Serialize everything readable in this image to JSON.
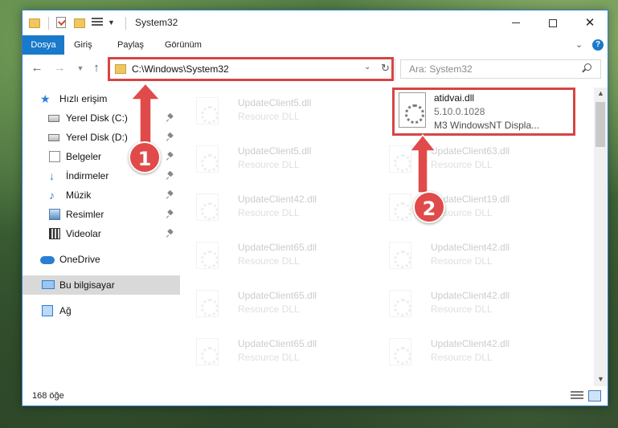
{
  "window": {
    "title": "System32"
  },
  "ribbon": {
    "tabs": [
      {
        "label": "Dosya"
      },
      {
        "label": "Giriş"
      },
      {
        "label": "Paylaş"
      },
      {
        "label": "Görünüm"
      }
    ]
  },
  "navigation": {
    "address": "C:\\Windows\\System32",
    "search_placeholder": "Ara: System32"
  },
  "sidebar": {
    "items": [
      {
        "label": "Hızlı erişim",
        "icon": "star-icon"
      },
      {
        "label": "Yerel Disk (C:)",
        "icon": "disk-icon",
        "pinned": true
      },
      {
        "label": "Yerel Disk (D:)",
        "icon": "disk-icon",
        "pinned": true
      },
      {
        "label": "Belgeler",
        "icon": "documents-icon",
        "pinned": true
      },
      {
        "label": "İndirmeler",
        "icon": "download-icon",
        "pinned": true
      },
      {
        "label": "Müzik",
        "icon": "music-icon",
        "pinned": true
      },
      {
        "label": "Resimler",
        "icon": "pictures-icon",
        "pinned": true
      },
      {
        "label": "Videolar",
        "icon": "videos-icon",
        "pinned": true
      },
      {
        "label": "OneDrive",
        "icon": "cloud-icon"
      },
      {
        "label": "Bu bilgisayar",
        "icon": "computer-icon",
        "selected": true
      },
      {
        "label": "Ağ",
        "icon": "network-icon"
      }
    ]
  },
  "files": {
    "target": {
      "name": "atidvai.dll",
      "version": "5.10.0.1028",
      "description": "M3 WindowsNT Displa..."
    },
    "left_column": [
      {
        "name": "UpdateClient5.dll",
        "type": "Resource DLL"
      },
      {
        "name": "UpdateClient5.dll",
        "type": "Resource DLL"
      },
      {
        "name": "UpdateClient42.dll",
        "type": "Resource DLL"
      },
      {
        "name": "UpdateClient65.dll",
        "type": "Resource DLL"
      },
      {
        "name": "UpdateClient65.dll",
        "type": "Resource DLL"
      },
      {
        "name": "UpdateClient65.dll",
        "type": "Resource DLL"
      }
    ],
    "right_column": [
      {
        "name": "UpdateClient63.dll",
        "type": "Resource DLL"
      },
      {
        "name": "UpdateClient19.dll",
        "type": "Resource DLL"
      },
      {
        "name": "UpdateClient42.dll",
        "type": "Resource DLL"
      },
      {
        "name": "UpdateClient42.dll",
        "type": "Resource DLL"
      },
      {
        "name": "UpdateClient42.dll",
        "type": "Resource DLL"
      }
    ]
  },
  "status": {
    "item_count": "168 öğe"
  },
  "callouts": [
    {
      "number": "1"
    },
    {
      "number": "2"
    }
  ],
  "colors": {
    "accent": "#1979ca",
    "highlight": "#d64545",
    "callout": "#e14a4a"
  }
}
